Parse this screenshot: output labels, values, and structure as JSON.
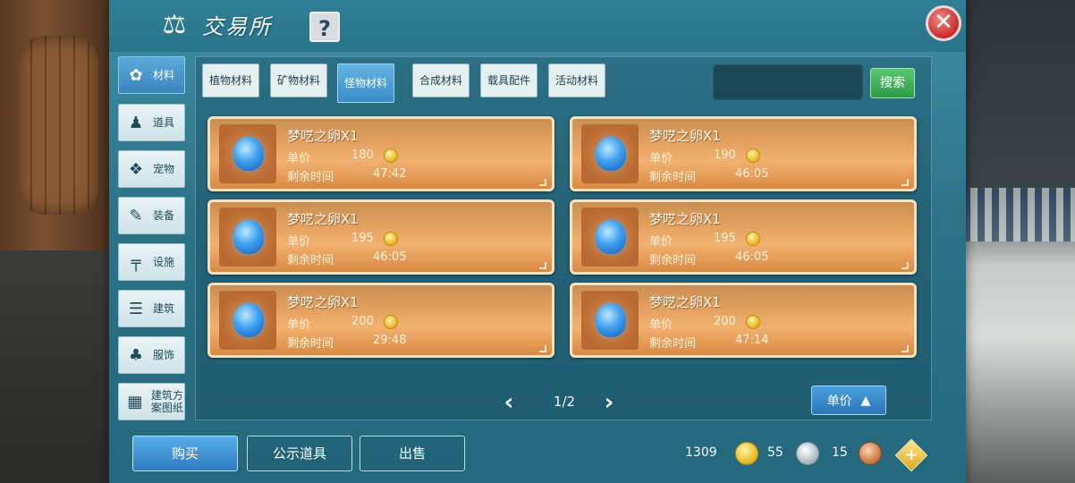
{
  "title": "交易所",
  "help_label": "?",
  "close_label": "✕",
  "categories": [
    {
      "label": "材料",
      "icon": "materials-icon",
      "glyph": "✿",
      "active": true
    },
    {
      "label": "道具",
      "icon": "item-icon",
      "glyph": "♟",
      "active": false
    },
    {
      "label": "宠物",
      "icon": "paw-icon",
      "glyph": "❖",
      "active": false
    },
    {
      "label": "装备",
      "icon": "equipment-icon",
      "glyph": "✎",
      "active": false
    },
    {
      "label": "设施",
      "icon": "facility-icon",
      "glyph": "╤",
      "active": false
    },
    {
      "label": "建筑",
      "icon": "building-icon",
      "glyph": "☰",
      "active": false
    },
    {
      "label": "服饰",
      "icon": "clothing-icon",
      "glyph": "♣",
      "active": false
    },
    {
      "label": "建筑方案图纸",
      "icon": "blueprint-icon",
      "glyph": "▦",
      "active": false
    }
  ],
  "tabs": [
    {
      "label": "植物材料",
      "active": false
    },
    {
      "label": "矿物材料",
      "active": false
    },
    {
      "label": "怪物材料",
      "active": true
    },
    {
      "label": "合成材料",
      "active": false
    },
    {
      "label": "载具配件",
      "active": false
    },
    {
      "label": "活动材料",
      "active": false
    }
  ],
  "search": {
    "placeholder": "",
    "button_label": "搜索"
  },
  "listings": [
    {
      "name": "梦呓之卵X1",
      "price_label": "单价",
      "price": "180",
      "time_label": "剩余时间",
      "time": "47:42"
    },
    {
      "name": "梦呓之卵X1",
      "price_label": "单价",
      "price": "190",
      "time_label": "剩余时间",
      "time": "46:05"
    },
    {
      "name": "梦呓之卵X1",
      "price_label": "单价",
      "price": "195",
      "time_label": "剩余时间",
      "time": "46:05"
    },
    {
      "name": "梦呓之卵X1",
      "price_label": "单价",
      "price": "195",
      "time_label": "剩余时间",
      "time": "46:05"
    },
    {
      "name": "梦呓之卵X1",
      "price_label": "单价",
      "price": "200",
      "time_label": "剩余时间",
      "time": "29:48"
    },
    {
      "name": "梦呓之卵X1",
      "price_label": "单价",
      "price": "200",
      "time_label": "剩余时间",
      "time": "47:14"
    }
  ],
  "pager": {
    "text": "1/2",
    "prev": "‹",
    "next": "›"
  },
  "sort": {
    "label": "单价",
    "arrow": "▲"
  },
  "actions": {
    "buy": "购买",
    "notice": "公示道具",
    "sell": "出售"
  },
  "currency": {
    "gold": "1309",
    "silver": "55",
    "copper": "15",
    "add": "+"
  },
  "colors": {
    "panel": "#2c7388",
    "card": "#e8a462",
    "active_tab": "#3a8cc8",
    "search_button": "#2e9c46",
    "close": "#c82a2a"
  }
}
